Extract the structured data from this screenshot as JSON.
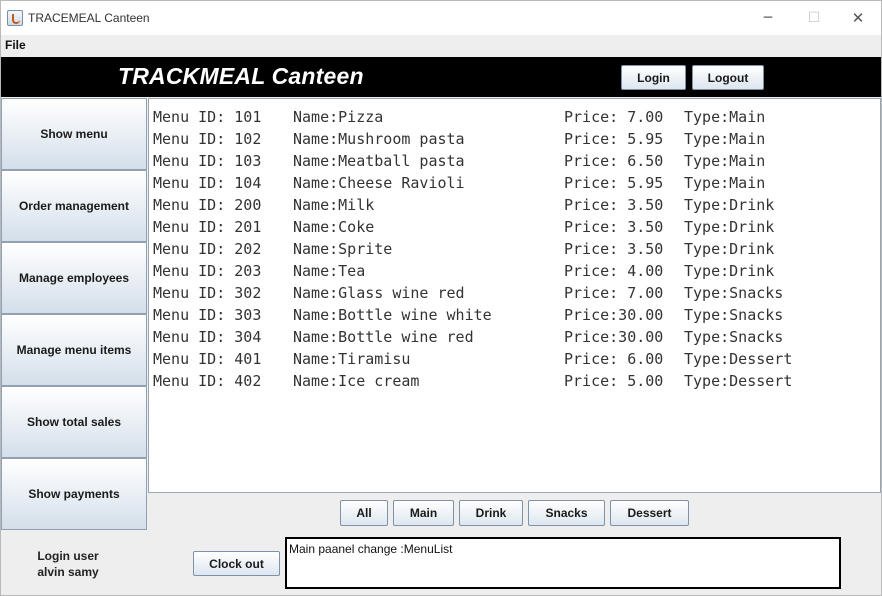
{
  "window": {
    "title": "TRACEMEAL Canteen",
    "minimize_glyph": "─",
    "maximize_glyph": "☐",
    "close_glyph": "✕"
  },
  "menubar": {
    "file": "File"
  },
  "header": {
    "title": "TRACKMEAL Canteen",
    "login": "Login",
    "logout": "Logout"
  },
  "sidebar": [
    {
      "label": "Show menu"
    },
    {
      "label": "Order management"
    },
    {
      "label": "Manage employees"
    },
    {
      "label": "Manage menu items"
    },
    {
      "label": "Show total sales"
    },
    {
      "label": "Show payments"
    }
  ],
  "menu_items": [
    {
      "id": "Menu ID: 101",
      "name": "Name:Pizza",
      "price": "Price: 7.00",
      "type": "Type:Main"
    },
    {
      "id": "Menu ID: 102",
      "name": "Name:Mushroom pasta",
      "price": "Price: 5.95",
      "type": "Type:Main"
    },
    {
      "id": "Menu ID: 103",
      "name": "Name:Meatball pasta",
      "price": "Price: 6.50",
      "type": "Type:Main"
    },
    {
      "id": "Menu ID: 104",
      "name": "Name:Cheese Ravioli",
      "price": "Price: 5.95",
      "type": "Type:Main"
    },
    {
      "id": "Menu ID: 200",
      "name": "Name:Milk",
      "price": "Price: 3.50",
      "type": "Type:Drink"
    },
    {
      "id": "Menu ID: 201",
      "name": "Name:Coke",
      "price": "Price: 3.50",
      "type": "Type:Drink"
    },
    {
      "id": "Menu ID: 202",
      "name": "Name:Sprite",
      "price": "Price: 3.50",
      "type": "Type:Drink"
    },
    {
      "id": "Menu ID: 203",
      "name": "Name:Tea",
      "price": "Price: 4.00",
      "type": "Type:Drink"
    },
    {
      "id": "Menu ID: 302",
      "name": "Name:Glass wine red",
      "price": "Price: 7.00",
      "type": "Type:Snacks"
    },
    {
      "id": "Menu ID: 303",
      "name": "Name:Bottle wine white",
      "price": "Price:30.00",
      "type": "Type:Snacks"
    },
    {
      "id": "Menu ID: 304",
      "name": "Name:Bottle wine red",
      "price": "Price:30.00",
      "type": "Type:Snacks"
    },
    {
      "id": "Menu ID: 401",
      "name": "Name:Tiramisu",
      "price": "Price: 6.00",
      "type": "Type:Dessert"
    },
    {
      "id": "Menu ID: 402",
      "name": "Name:Ice cream",
      "price": "Price: 5.00",
      "type": "Type:Dessert"
    }
  ],
  "filters": {
    "all": "All",
    "main": "Main",
    "drink": "Drink",
    "snacks": "Snacks",
    "dessert": "Dessert"
  },
  "footer": {
    "login_user_label": "Login user",
    "login_user_name": "alvin samy",
    "clock_out": "Clock out",
    "status": "Main paanel change :MenuList"
  },
  "colors": {
    "header_bg": "#000000",
    "header_text": "#ffffff",
    "panel_bg": "#ffffff",
    "window_bg": "#eeeeee"
  }
}
